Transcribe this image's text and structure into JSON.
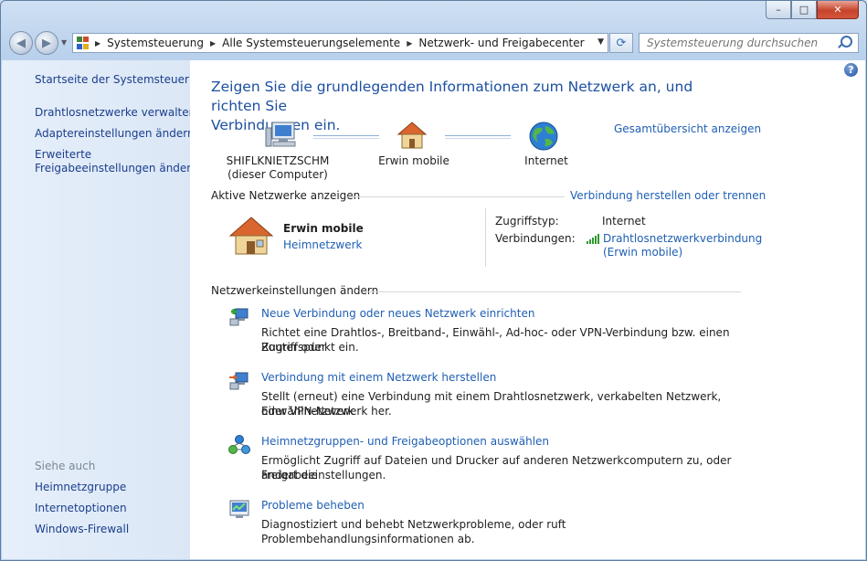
{
  "window": {
    "caption": {
      "minimize": "–",
      "maximize": "□",
      "close": "✕"
    }
  },
  "nav": {
    "back": "◀",
    "forward": "▶",
    "breadcrumbs": [
      "Systemsteuerung",
      "Alle Systemsteuerungselemente",
      "Netzwerk- und Freigabecenter"
    ],
    "refresh": "⟳",
    "search_placeholder": "Systemsteuerung durchsuchen"
  },
  "sidebar": {
    "top_links": [
      "Startseite der Systemsteuerung",
      "Drahtlosnetzwerke verwalten",
      "Adaptereinstellungen ändern",
      "Erweiterte",
      "Freigabeeinstellungen ändern"
    ],
    "see_also_heading": "Siehe auch",
    "see_also_links": [
      "Heimnetzgruppe",
      "Internetoptionen",
      "Windows-Firewall"
    ]
  },
  "main": {
    "help": "?",
    "title_line1": "Zeigen Sie die grundlegenden Informationen zum Netzwerk an, und richten Sie",
    "title_line2": "Verbindungen ein.",
    "full_map_link": "Gesamtübersicht anzeigen",
    "map": {
      "computer_name": "SHIFLKNIETZSCHM",
      "computer_sub": "(dieser Computer)",
      "network": "Erwin mobile",
      "internet": "Internet"
    },
    "active": {
      "heading": "Aktive Netzwerke anzeigen",
      "connect_link": "Verbindung herstellen oder trennen",
      "network_name": "Erwin mobile",
      "network_type": "Heimnetzwerk",
      "access_label": "Zugriffstyp:",
      "access_value": "Internet",
      "connections_label": "Verbindungen:",
      "connection_line1": "Drahtlosnetzwerkverbindung",
      "connection_line2": "(Erwin mobile)"
    },
    "settings": {
      "heading": "Netzwerkeinstellungen ändern",
      "tasks": [
        {
          "link": "Neue Verbindung oder neues Netzwerk einrichten",
          "desc1": "Richtet eine Drahtlos-, Breitband-, Einwähl-, Ad-hoc- oder VPN-Verbindung bzw. einen Router oder",
          "desc2": "Zugriffspunkt ein."
        },
        {
          "link": "Verbindung mit einem Netzwerk herstellen",
          "desc1": "Stellt (erneut) eine Verbindung mit einem Drahtlosnetzwerk, verkabelten Netzwerk, Einwählnetzwerk",
          "desc2": "oder VPN-Netzwerk her."
        },
        {
          "link": "Heimnetzgruppen- und Freigabeoptionen auswählen",
          "desc1": "Ermöglicht Zugriff auf Dateien und Drucker auf anderen Netzwerkcomputern zu, oder ändert die",
          "desc2": "Freigabeeinstellungen."
        },
        {
          "link": "Probleme beheben",
          "desc1": "Diagnostiziert und behebt Netzwerkprobleme, oder ruft Problembehandlungsinformationen ab.",
          "desc2": ""
        }
      ]
    }
  }
}
